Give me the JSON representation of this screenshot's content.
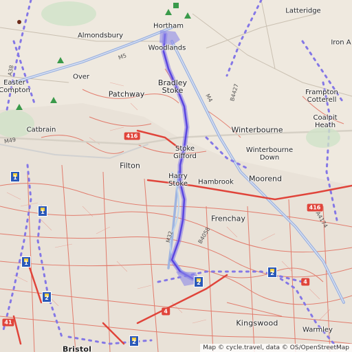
{
  "map": {
    "attribution": "Map © cycle.travel, data © OS/OpenStreetMap",
    "places": [
      {
        "id": "latteridge",
        "label": "Latteridge"
      },
      {
        "id": "almondsbury",
        "label": "Almondsbury"
      },
      {
        "id": "hortham",
        "label": "Hortham"
      },
      {
        "id": "woodlands",
        "label": "Woodlands"
      },
      {
        "id": "iron-acton",
        "label": "Iron A"
      },
      {
        "id": "over",
        "label": "Over"
      },
      {
        "id": "easter-compton",
        "label": "Easter\nCompton"
      },
      {
        "id": "patchway",
        "label": "Patchway"
      },
      {
        "id": "bradley-stoke",
        "label": "Bradley\nStoke"
      },
      {
        "id": "frampton-cotterell",
        "label": "Frampton\nCotterell"
      },
      {
        "id": "coalpit-heath",
        "label": "Coalpit\nHeath"
      },
      {
        "id": "catbrain",
        "label": "Catbrain"
      },
      {
        "id": "winterbourne",
        "label": "Winterbourne"
      },
      {
        "id": "winterbourne-down",
        "label": "Winterbourne\nDown"
      },
      {
        "id": "stoke-gifford",
        "label": "Stoke\nGifford"
      },
      {
        "id": "filton",
        "label": "Filton"
      },
      {
        "id": "harry-stoke",
        "label": "Harry\nStoke"
      },
      {
        "id": "hambrook",
        "label": "Hambrook"
      },
      {
        "id": "moorend",
        "label": "Moorend"
      },
      {
        "id": "frenchay",
        "label": "Frenchay"
      },
      {
        "id": "kingswood",
        "label": "Kingswood"
      },
      {
        "id": "warmley",
        "label": "Warmley"
      },
      {
        "id": "bristol",
        "label": "Bristol"
      }
    ],
    "road_shields": [
      {
        "id": "a4174-west",
        "label": "416"
      },
      {
        "id": "a4174-east",
        "label": "416"
      },
      {
        "id": "a4-east",
        "label": "4"
      },
      {
        "id": "a4-centre",
        "label": "4"
      },
      {
        "id": "a4-west",
        "label": "41"
      }
    ],
    "road_labels": [
      {
        "id": "m5",
        "label": "M5"
      },
      {
        "id": "m4",
        "label": "M4"
      },
      {
        "id": "m32",
        "label": "M32"
      },
      {
        "id": "b4058",
        "label": "B4058"
      },
      {
        "id": "b4427",
        "label": "B4427"
      },
      {
        "id": "a38",
        "label": "A38"
      },
      {
        "id": "m49",
        "label": "M49"
      },
      {
        "id": "a4174",
        "label": "A4174"
      }
    ],
    "ncn_markers": [
      {
        "id": "ncn-1a",
        "label": "1"
      },
      {
        "id": "ncn-1b",
        "label": "1"
      },
      {
        "id": "ncn-1c",
        "label": "1"
      },
      {
        "id": "ncn-2a",
        "label": "2"
      },
      {
        "id": "ncn-2b",
        "label": "2"
      },
      {
        "id": "ncn-2c",
        "label": "2"
      },
      {
        "id": "ncn-2d",
        "label": "2"
      }
    ],
    "colors": {
      "background": "#efe9df",
      "minor_roads": "#e0443a",
      "motorway": "#9fb4e0",
      "route": "#6a5cf0",
      "ncn": "#2a58b8",
      "cycle_dots": "#8477e6"
    }
  }
}
